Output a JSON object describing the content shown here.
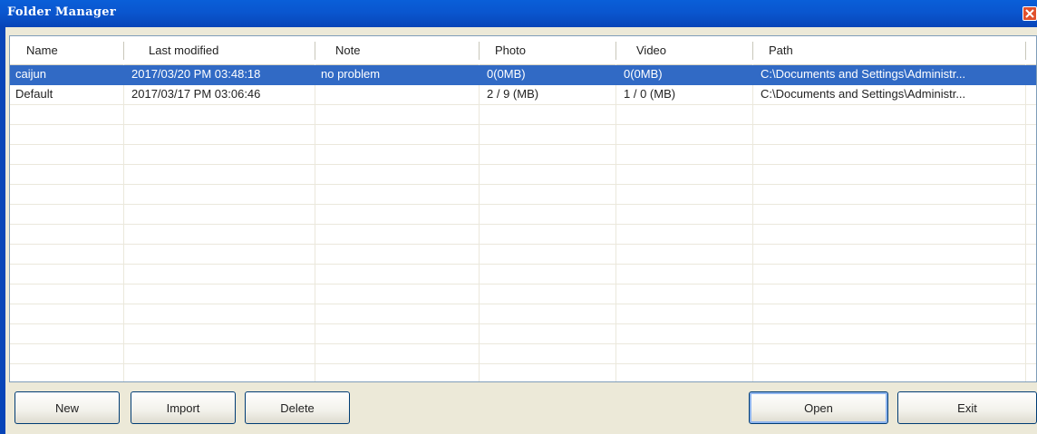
{
  "window": {
    "title": "Folder Manager"
  },
  "table": {
    "columns": [
      "Name",
      "Last modified",
      "Note",
      "Photo",
      "Video",
      "Path"
    ],
    "rows": [
      {
        "name": "caijun",
        "last_modified": "2017/03/20 PM 03:48:18",
        "note": "no problem",
        "photo": "0(0MB)",
        "video": "0(0MB)",
        "path": "C:\\Documents and Settings\\Administr...",
        "selected": true
      },
      {
        "name": "Default",
        "last_modified": "2017/03/17 PM 03:06:46",
        "note": "",
        "photo": "2 / 9 (MB)",
        "video": "1 / 0 (MB)",
        "path": "C:\\Documents and Settings\\Administr...",
        "selected": false
      }
    ]
  },
  "buttons": {
    "new": "New",
    "import": "Import",
    "delete": "Delete",
    "open": "Open",
    "exit": "Exit"
  },
  "colors": {
    "titlebar": "#0a56cf",
    "selection": "#316ac5",
    "dialog_bg": "#ece9d8"
  },
  "icons": {
    "close": "close-x-icon"
  }
}
